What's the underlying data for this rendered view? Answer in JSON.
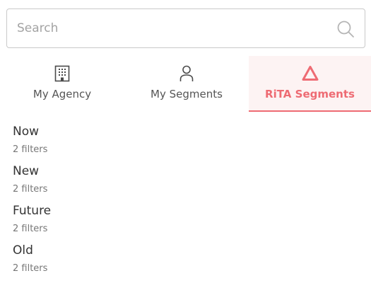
{
  "search": {
    "placeholder": "Search",
    "value": "",
    "icon": "search-icon"
  },
  "tabs": [
    {
      "label": "My Agency",
      "icon": "building-icon",
      "active": false
    },
    {
      "label": "My Segments",
      "icon": "user-icon",
      "active": false
    },
    {
      "label": "RiTA Segments",
      "icon": "triangle-icon",
      "active": true
    }
  ],
  "colors": {
    "accent": "#ee6b73",
    "active_tab_bg": "#fdf3f3",
    "text": "#333333",
    "muted": "#777777",
    "border": "#c9c9c9"
  },
  "segments": [
    {
      "title": "Now",
      "subtitle": "2 filters"
    },
    {
      "title": "New",
      "subtitle": "2 filters"
    },
    {
      "title": "Future",
      "subtitle": "2 filters"
    },
    {
      "title": "Old",
      "subtitle": "2 filters"
    }
  ]
}
